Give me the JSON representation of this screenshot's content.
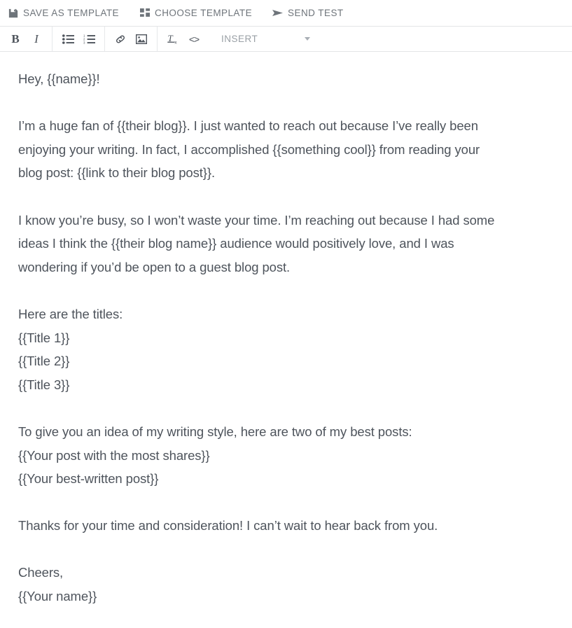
{
  "action_bar": {
    "buttons": [
      {
        "id": "save-as-template",
        "label": "SAVE AS TEMPLATE",
        "icon": "floppy-disk-icon"
      },
      {
        "id": "choose-template",
        "label": "CHOOSE TEMPLATE",
        "icon": "grid-layout-icon"
      },
      {
        "id": "send-test",
        "label": "SEND TEST",
        "icon": "paper-plane-icon"
      }
    ]
  },
  "toolbar": {
    "bold_label": "B",
    "italic_label": "I",
    "code_label": "<>",
    "insert_label": "INSERT",
    "buttons": [
      {
        "id": "bold",
        "name": "bold-icon",
        "title": "Bold"
      },
      {
        "id": "italic",
        "name": "italic-icon",
        "title": "Italic"
      },
      {
        "id": "unordered-list",
        "name": "unordered-list-icon",
        "title": "Bulleted list"
      },
      {
        "id": "ordered-list",
        "name": "ordered-list-icon",
        "title": "Numbered list"
      },
      {
        "id": "link",
        "name": "link-icon",
        "title": "Insert link"
      },
      {
        "id": "image",
        "name": "image-icon",
        "title": "Insert image"
      },
      {
        "id": "clear-formatting",
        "name": "clear-formatting-icon",
        "title": "Clear formatting"
      },
      {
        "id": "code",
        "name": "code-icon",
        "title": "Code view"
      }
    ]
  },
  "editor": {
    "paragraphs": [
      {
        "id": "greeting",
        "lines": [
          "Hey, {{name}}!"
        ]
      },
      {
        "id": "intro",
        "lines": [
          "I’m a huge fan of {{their blog}}. I just wanted to reach out because I’ve really been",
          "enjoying your writing. In fact, I accomplished {{something cool}} from reading your",
          "blog post: {{link to their blog post}}."
        ]
      },
      {
        "id": "pitch",
        "lines": [
          "I know you’re busy, so I won’t waste your time. I’m reaching out because I had some",
          "ideas I think the {{their blog name}} audience would positively love, and I was",
          "wondering if you’d be open to a guest blog post."
        ]
      },
      {
        "id": "titles",
        "lines": [
          "Here are the titles:",
          "{{Title 1}}",
          "{{Title 2}}",
          "{{Title 3}}"
        ]
      },
      {
        "id": "samples",
        "lines": [
          "To give you an idea of my writing style, here are two of my best posts:",
          "{{Your post with the most shares}}",
          "{{Your best-written post}}"
        ]
      },
      {
        "id": "thanks",
        "lines": [
          "Thanks for your time and consideration! I can’t wait to hear back from you."
        ]
      },
      {
        "id": "signoff",
        "lines": [
          "Cheers,",
          "{{Your name}}"
        ]
      }
    ]
  },
  "colors": {
    "text": "#4e545c",
    "muted_text": "#6e747a",
    "placeholder_text": "#9aa0a6",
    "border": "#e3e5e7",
    "background": "#ffffff"
  }
}
